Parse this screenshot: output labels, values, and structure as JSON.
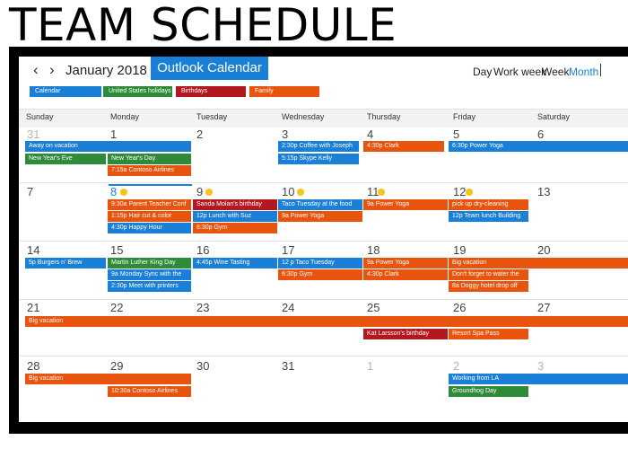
{
  "poster": {
    "title": "TEAM SCHEDULE"
  },
  "toolbar": {
    "prev_icon": "‹",
    "next_icon": "›",
    "month": "January 2018",
    "chevron": "⌄",
    "app_name": "Outlook Calendar"
  },
  "views": [
    {
      "label": "Day",
      "active": false
    },
    {
      "label": "Work week",
      "active": false
    },
    {
      "label": "Week",
      "active": false
    },
    {
      "label": "Month",
      "active": true
    }
  ],
  "calendars": [
    {
      "label": "Calendar",
      "color": "#1a7fd6"
    },
    {
      "label": "United States holidays",
      "color": "#2e8b39"
    },
    {
      "label": "Birthdays",
      "color": "#b3171f"
    },
    {
      "label": "Family",
      "color": "#e8530e"
    }
  ],
  "weekdays": [
    "Sunday",
    "Monday",
    "Tuesday",
    "Wednesday",
    "Thursday",
    "Friday",
    "Saturday"
  ],
  "weeks": [
    {
      "days": [
        "31",
        "1",
        "2",
        "3",
        "4",
        "5",
        "6"
      ]
    },
    {
      "days": [
        "7",
        "8",
        "9",
        "10",
        "11",
        "12",
        "13"
      ]
    },
    {
      "days": [
        "14",
        "15",
        "16",
        "17",
        "18",
        "19",
        "20"
      ]
    },
    {
      "days": [
        "21",
        "22",
        "23",
        "24",
        "25",
        "26",
        "27"
      ]
    },
    {
      "days": [
        "28",
        "29",
        "30",
        "31",
        "1",
        "2",
        "3"
      ]
    }
  ],
  "events": {
    "w1": {
      "away": "Away on vacation",
      "nye": "New Year's Eve",
      "nyd": "New Year's Day",
      "contoso": "7:15a Contoso Airlines",
      "coffee": "2:30p Coffee with Joseph",
      "skype": "5:15p Skype Kelly",
      "clark": "4:30p Clark",
      "yoga": "6:30p Power Yoga"
    },
    "w2": {
      "ptc": "9:30a Parent Teacher Conf",
      "hair": "1:15p Hair cut & color",
      "happy": "4:30p Happy Hour",
      "sanda": "Sanda Molan's birthday",
      "lunch": "12p Lunch with Suz",
      "gym": "6:30p Gym",
      "taco": "Taco Tuesday at the food",
      "yoga": "9a Power Yoga",
      "yoga2": "9a Power Yoga",
      "dry": "pick up dry-cleaning",
      "team": "12p Team lunch Building"
    },
    "w3": {
      "burgers": "5p Burgers n' Brew",
      "mlk": "Martin Luther King Day",
      "sync": "9a Monday Sync with the",
      "printers": "2:30p Meet with printers",
      "wine": "4:45p Wine Tasting",
      "taco": "12 p Taco Tuesday",
      "gym": "6:30p Gym",
      "yoga": "9a Power Yoga",
      "clark": "4:30p Clark",
      "bigvac": "Big vacation",
      "water": "Don't forget to water the",
      "doggy": "8a Doggy hotel drop off"
    },
    "w4": {
      "bigvac": "Big vacation",
      "kat": "Kat Larsson's birthday",
      "spa": "Resort Spa Pass"
    },
    "w5": {
      "bigvac": "Big vacation",
      "contoso": "10:30a Contoso Airlines",
      "la": "Working from LA",
      "groundhog": "Groundhog Day"
    }
  }
}
